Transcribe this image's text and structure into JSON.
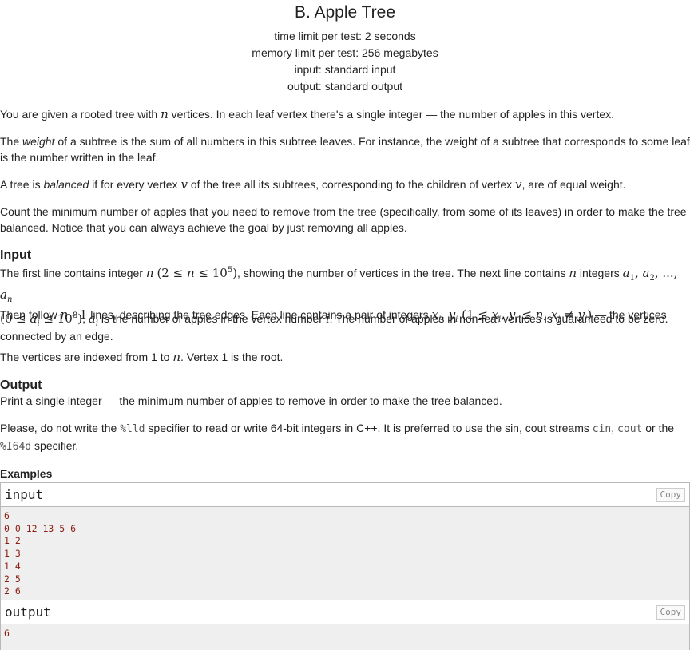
{
  "header": {
    "title": "B. Apple Tree",
    "time_limit": "time limit per test: 2 seconds",
    "memory_limit": "memory limit per test: 256 megabytes",
    "input_file": "input: standard input",
    "output_file": "output: standard output"
  },
  "statement": {
    "p1_a": "You are given a rooted tree with ",
    "p1_b": " vertices. In each leaf vertex there's a single integer — the number of apples in this vertex.",
    "p2_a": "The ",
    "p2_weight": "weight",
    "p2_b": " of a subtree is the sum of all numbers in this subtree leaves. For instance, the weight of a subtree that corresponds to some leaf is the number written in the leaf.",
    "p3_a": "A tree is ",
    "p3_balanced": "balanced",
    "p3_b": " if for every vertex ",
    "p3_c": " of the tree all its subtrees, corresponding to the children of vertex ",
    "p3_d": ", are of equal weight.",
    "p4": "Count the minimum number of apples that you need to remove from the tree (specifically, from some of its leaves) in order to make the tree balanced. Notice that you can always achieve the goal by just removing all apples."
  },
  "math": {
    "n": "n",
    "v": "v",
    "i": "i",
    "one": "1"
  },
  "input_section": {
    "title": "Input",
    "l1_a": "The first line contains integer ",
    "l1_b": ", showing the number of vertices in the tree. The next line contains ",
    "l1_c": " integers ",
    "l1_d": " is the number of apples in the vertex number ",
    "l1_e": ". The number of apples in non-leaf vertices is guaranteed to be zero.",
    "l2_a": "Then follow ",
    "l2_b": " lines, describing the tree edges. Each line contains a pair of integers ",
    "l2_c": " — the vertices connected by an edge.",
    "l3_a": "The vertices are indexed from 1 to ",
    "l3_b": ". Vertex 1 is the root."
  },
  "output_section": {
    "title": "Output",
    "l1": "Print a single integer — the minimum number of apples to remove in order to make the tree balanced.",
    "l2_a": "Please, do not write the ",
    "l2_code1": "%lld",
    "l2_b": " specifier to read or write 64-bit integers in C++. It is preferred to use the sin, cout streams ",
    "l2_code2": "cin",
    "l2_c": ", ",
    "l2_code3": "cout",
    "l2_d": " or the ",
    "l2_code4": "%I64d",
    "l2_e": " specifier."
  },
  "examples": {
    "title": "Examples",
    "input_label": "input",
    "output_label": "output",
    "copy_label": "Copy",
    "input_text": "6\n0 0 12 13 5 6\n1 2\n1 3\n1 4\n2 5\n2 6",
    "output_text": "6"
  }
}
